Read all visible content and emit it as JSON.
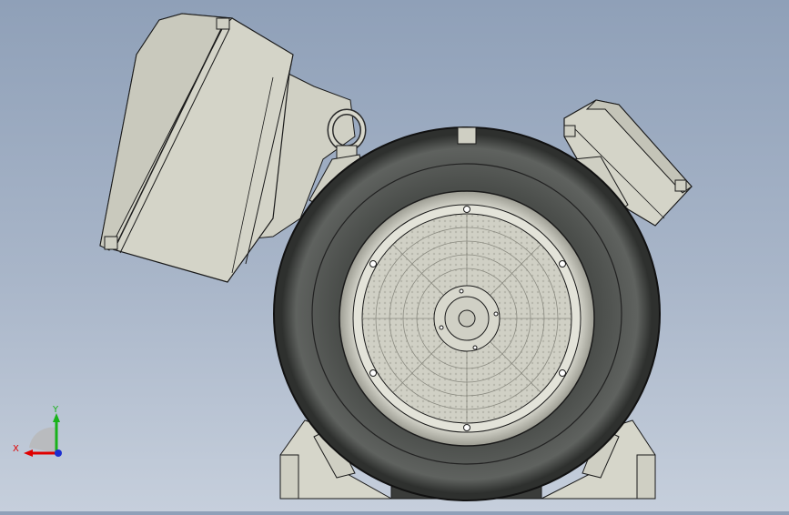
{
  "viewport": {
    "background_top": "#8fa0b8",
    "background_bottom": "#c6cfdc"
  },
  "model": {
    "body_color": "#d3d3c6",
    "frame_dark": "#3a3c3a",
    "frame_mid": "#5a5d5a",
    "fan_cover": "#cfcfc4",
    "edge_color": "#1a1a1a"
  },
  "triad": {
    "x_label": "X",
    "y_label": "Y",
    "x_color": "#e00000",
    "y_color": "#19b219",
    "z_color": "#1d2fd0"
  }
}
